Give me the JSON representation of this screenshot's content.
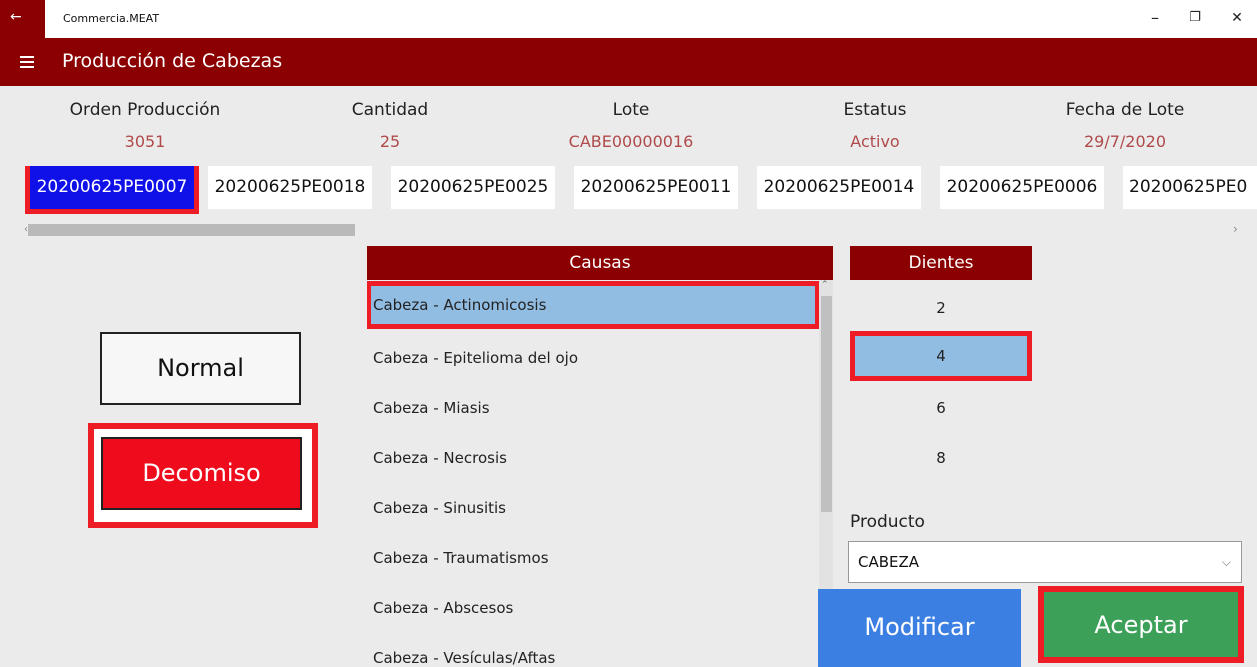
{
  "window": {
    "title": "Commercia.MEAT",
    "back_glyph": "←",
    "minimize_glyph": "–",
    "restore_glyph": "❐",
    "close_glyph": "✕"
  },
  "header": {
    "title": "Producción de Cabezas"
  },
  "info": [
    {
      "label": "Orden Producción",
      "value": "3051"
    },
    {
      "label": "Cantidad",
      "value": "25"
    },
    {
      "label": "Lote",
      "value": "CABE00000016"
    },
    {
      "label": "Estatus",
      "value": "Activo"
    },
    {
      "label": "Fecha de Lote",
      "value": "29/7/2020"
    }
  ],
  "lots": {
    "selected_index": 0,
    "items": [
      "20200625PE0007",
      "20200625PE0018",
      "20200625PE0025",
      "20200625PE0011",
      "20200625PE0014",
      "20200625PE0006",
      "20200625PE0"
    ]
  },
  "buttons": {
    "normal": "Normal",
    "decomiso": "Decomiso",
    "modificar": "Modificar",
    "aceptar": "Aceptar"
  },
  "causas": {
    "header": "Causas",
    "selected_index": 0,
    "items": [
      "Cabeza - Actinomicosis",
      "Cabeza - Epitelioma del ojo",
      "Cabeza - Miasis",
      "Cabeza - Necrosis",
      "Cabeza - Sinusitis",
      "Cabeza - Traumatismos",
      "Cabeza - Abscesos",
      "Cabeza - Vesículas/Aftas"
    ]
  },
  "dientes": {
    "header": "Dientes",
    "selected_index": 1,
    "items": [
      "2",
      "4",
      "6",
      "8"
    ]
  },
  "producto": {
    "label": "Producto",
    "value": "CABEZA"
  },
  "colors": {
    "header": "#8b0000",
    "selected_lot": "#1010e8",
    "highlight": "#ee1c24",
    "selection": "#92bde3",
    "modificar": "#3c7fe3",
    "aceptar": "#3da058",
    "info_value": "#b04a4a"
  }
}
